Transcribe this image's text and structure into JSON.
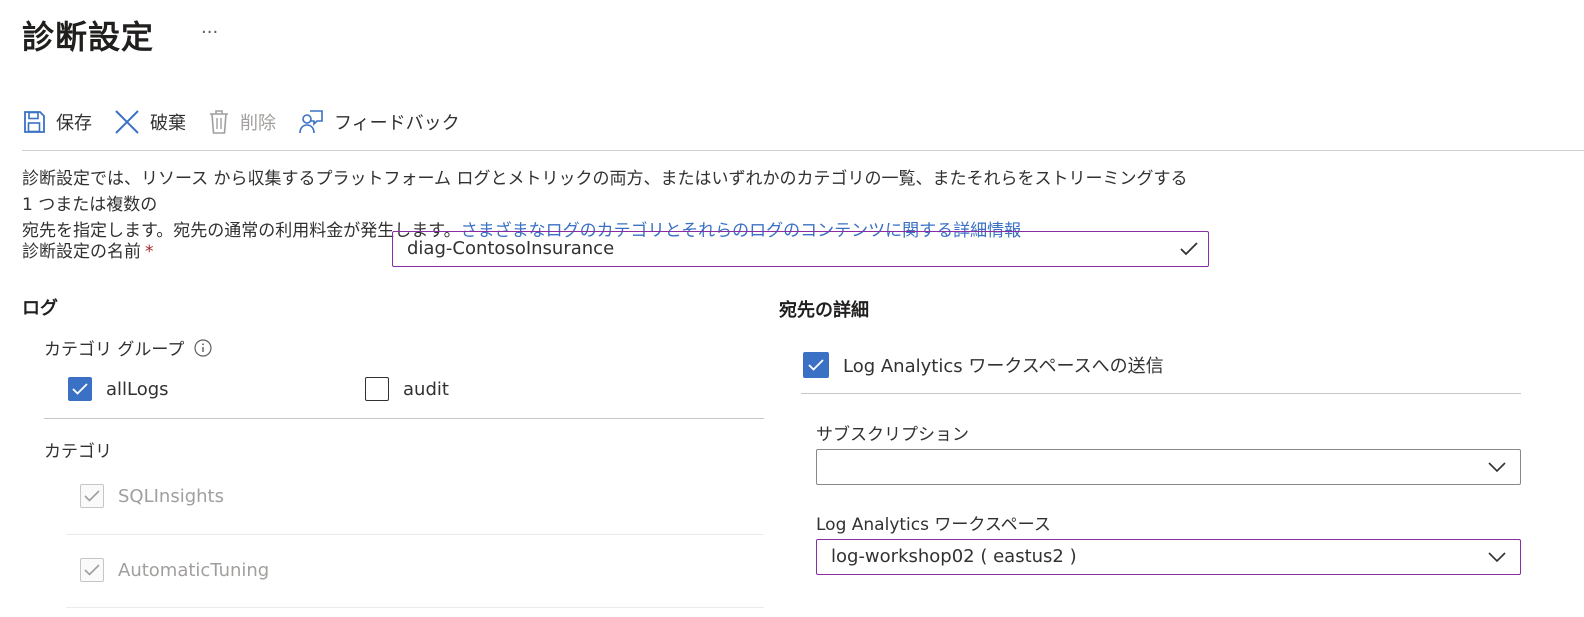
{
  "page": {
    "title": "診断設定",
    "more": "···"
  },
  "toolbar": {
    "save_label": "保存",
    "discard_label": "破棄",
    "delete_label": "削除",
    "feedback_label": "フィードバック"
  },
  "description": {
    "line1": "診断設定では、リソース から収集するプラットフォーム ログとメトリックの両方、またはいずれかのカテゴリの一覧、またそれらをストリーミングする 1 つまたは複数の",
    "line2_text": "宛先を指定します。宛先の通常の利用料金が発生します。",
    "link": "さまざまなログのカテゴリとそれらのログのコンテンツに関する詳細情報"
  },
  "name_field": {
    "label": "診断設定の名前",
    "required_mark": "*",
    "value": "diag-ContosoInsurance"
  },
  "logs": {
    "heading": "ログ",
    "category_group_label": "カテゴリ グループ",
    "groups": [
      {
        "label": "allLogs",
        "checked": true
      },
      {
        "label": "audit",
        "checked": false
      }
    ],
    "category_label": "カテゴリ",
    "categories": [
      {
        "label": "SQLInsights",
        "checked": true,
        "disabled": true
      },
      {
        "label": "AutomaticTuning",
        "checked": true,
        "disabled": true
      }
    ]
  },
  "destination": {
    "heading": "宛先の詳細",
    "send_to_la_label": "Log Analytics ワークスペースへの送信",
    "send_to_la_checked": true,
    "subscription_label": "サブスクリプション",
    "subscription_value": "",
    "workspace_label": "Log Analytics ワークスペース",
    "workspace_value": "log-workshop02 ( eastus2 )"
  },
  "colors": {
    "accent": "#3a71c4",
    "focus_border": "#8a2da5",
    "link": "#3a71c4"
  }
}
